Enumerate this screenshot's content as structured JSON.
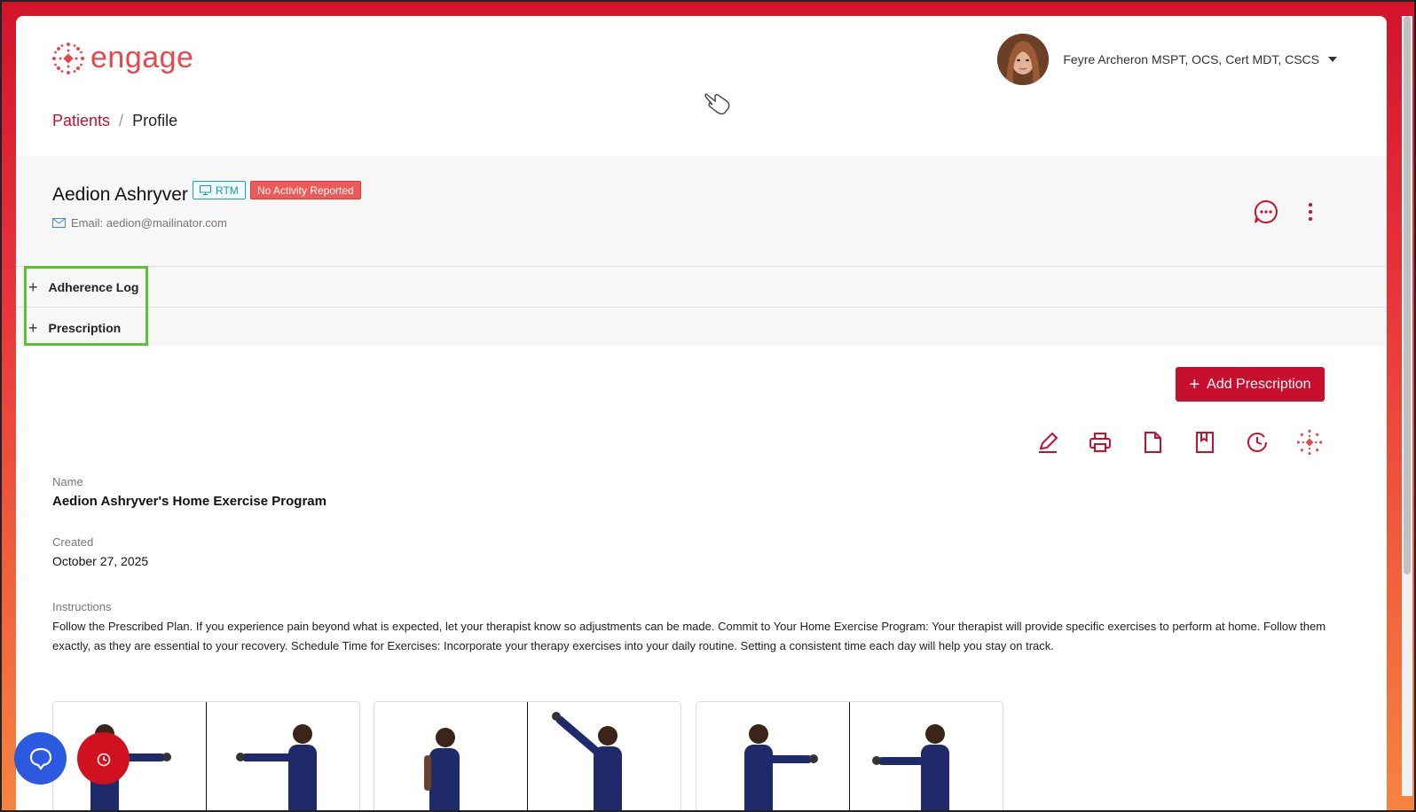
{
  "brand": {
    "name": "engage",
    "accent": "#c8102e",
    "logo_color": "#e8474c"
  },
  "user": {
    "name": "Feyre Archeron MSPT, OCS, Cert MDT, CSCS"
  },
  "breadcrumb": {
    "parent": "Patients",
    "separator": "/",
    "current": "Profile"
  },
  "patient": {
    "name": "Aedion Ashryver",
    "badges": {
      "rtm": "RTM",
      "activity": "No Activity Reported"
    },
    "email": "Email: aedion@mailinator.com"
  },
  "accordion": [
    {
      "label": "Adherence Log"
    },
    {
      "label": "Prescription"
    }
  ],
  "prescription": {
    "add_label": "Add Prescription",
    "tools": [
      "edit-icon",
      "print-icon",
      "document-icon",
      "bookmark-icon",
      "history-icon",
      "engage-logo-icon"
    ],
    "name_label": "Name",
    "name_value": "Aedion Ashryver's Home Exercise Program",
    "created_label": "Created",
    "created_value": "October 27, 2025",
    "instructions_label": "Instructions",
    "instructions_value": "Follow the Prescribed Plan. If you experience pain beyond what is expected, let your therapist know so adjustments can be made. Commit to Your Home Exercise Program: Your therapist will provide specific exercises to perform at home. Follow them exactly, as they are essential to your recovery. Schedule Time for Exercises: Incorporate your therapy exercises into your daily routine. Setting a consistent time each day will help you stay on track."
  },
  "colors": {
    "rtm": "#1a9aa8",
    "activity_bg": "#ee5a5a",
    "help": "#2b59e0"
  }
}
